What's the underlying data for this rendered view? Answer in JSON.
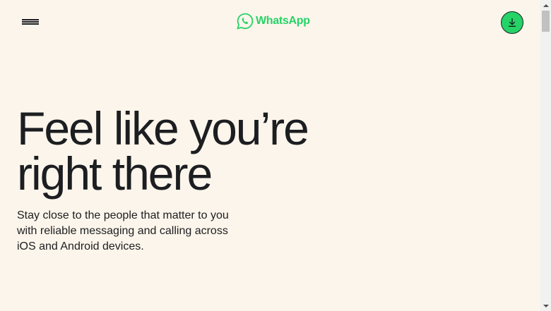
{
  "header": {
    "menu_icon": "hamburger-menu-icon",
    "logo_icon": "whatsapp-logo-icon",
    "logo_text": "WhatsApp",
    "download_icon": "download-arrow-icon"
  },
  "hero": {
    "title_line1": "Feel like you’re",
    "title_line2": "right there",
    "subtitle": "Stay close to the people that matter to you with reliable messaging and calling across iOS and Android devices."
  },
  "colors": {
    "background": "#fcf5eb",
    "brand_green": "#25d366",
    "text": "#1c1e21"
  }
}
